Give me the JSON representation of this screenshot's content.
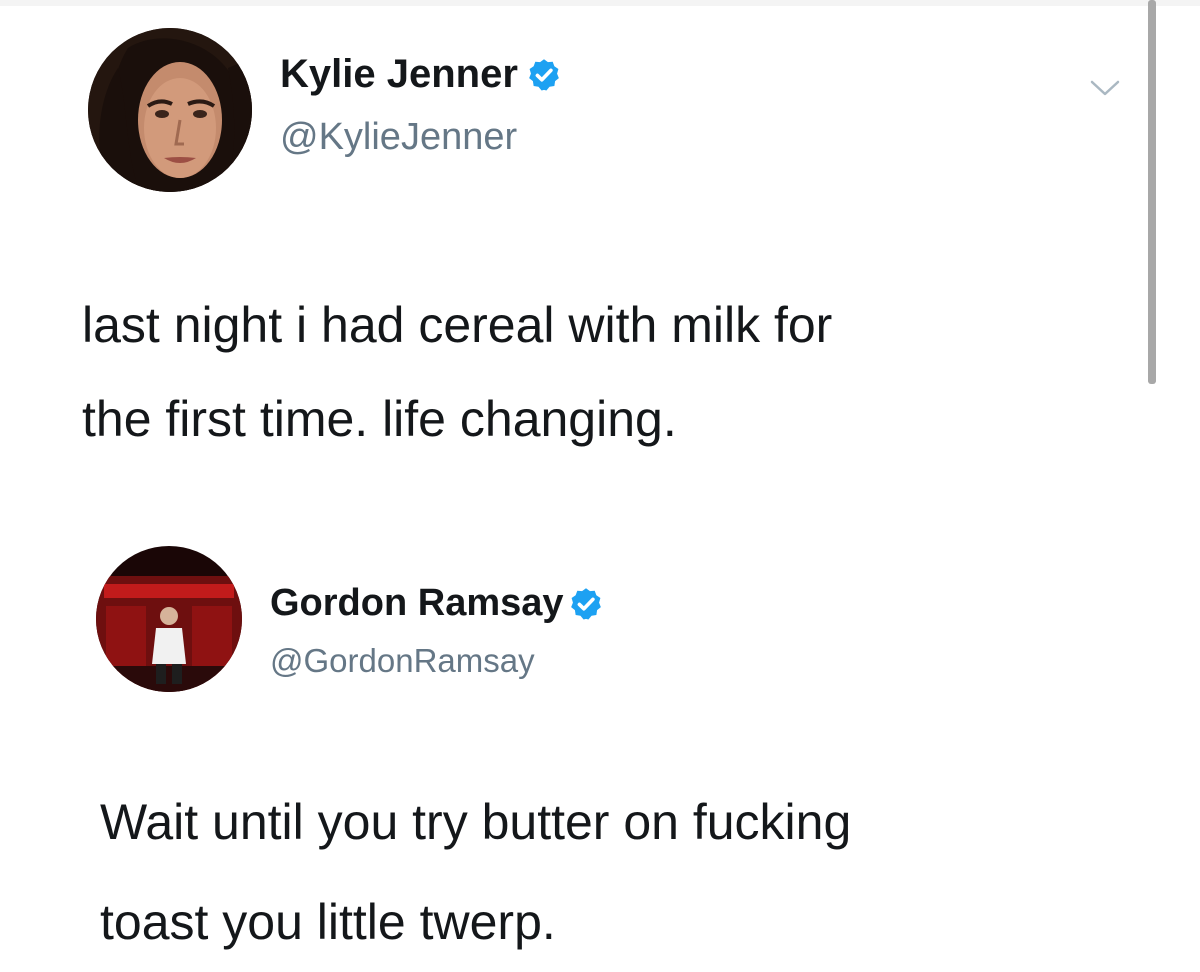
{
  "tweets": [
    {
      "display_name": "Kylie Jenner",
      "handle": "@KylieJenner",
      "verified": true,
      "text_lines": [
        "last night i had cereal with milk for",
        "the first time. life changing."
      ]
    },
    {
      "display_name": "Gordon Ramsay",
      "handle": "@GordonRamsay",
      "verified": true,
      "text_lines": [
        "Wait until you try butter on fucking",
        "toast you little twerp."
      ]
    }
  ],
  "icons": {
    "verified": "verified-badge-icon",
    "menu": "chevron-down-icon"
  },
  "colors": {
    "verified_blue": "#1da1f2",
    "text": "#14171a",
    "handle": "#657786"
  }
}
